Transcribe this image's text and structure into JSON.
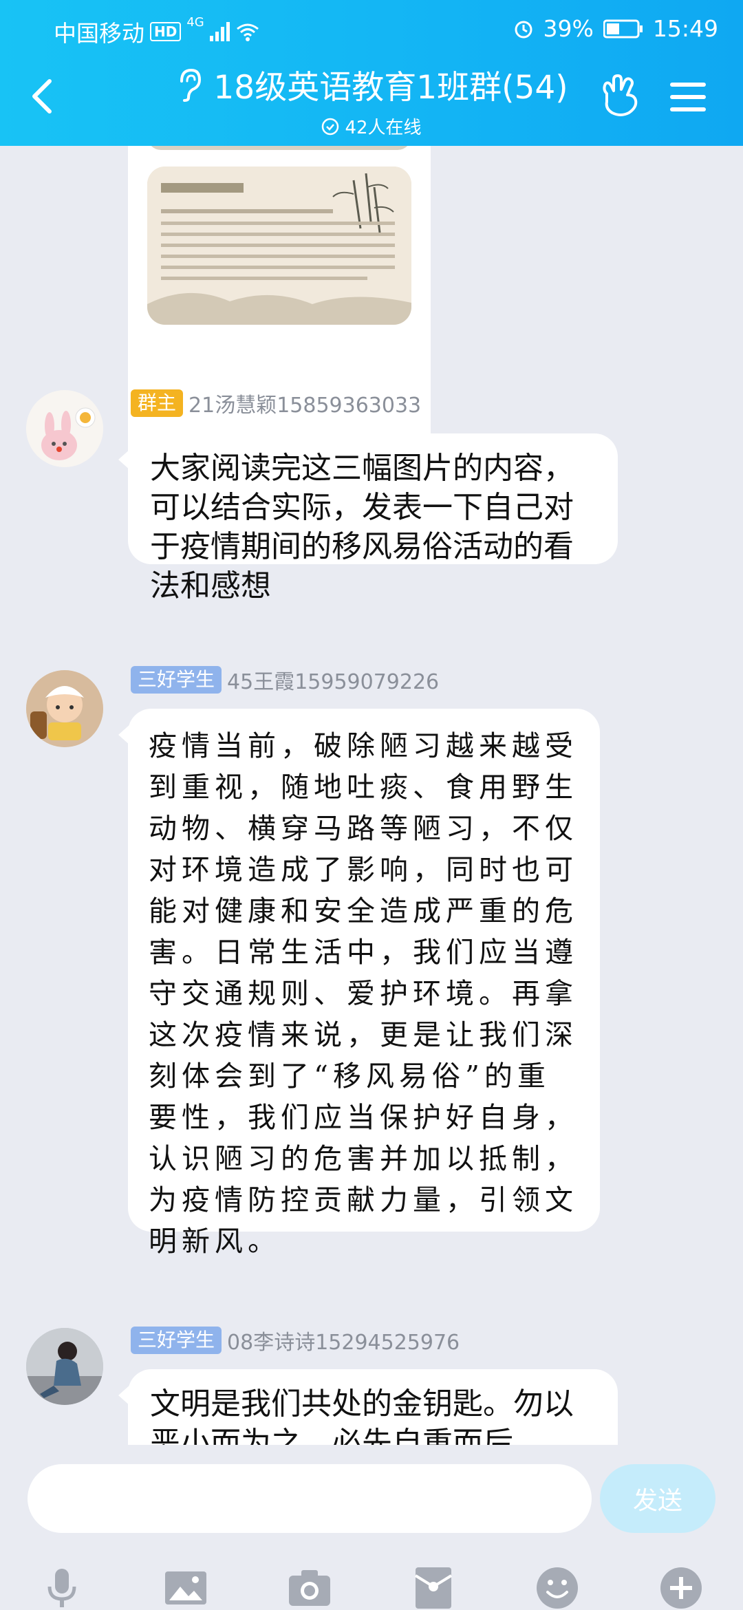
{
  "status_bar": {
    "carrier": "中国移动",
    "hd": "HD",
    "network": "4G",
    "battery": "39%",
    "time": "15:49"
  },
  "header": {
    "title": "18级英语教育1班群(54)",
    "online": "42人在线"
  },
  "messages": [
    {
      "badge": "群主",
      "sender": "21汤慧颖15859363033",
      "text": "大家阅读完这三幅图片的内容，可以结合实际，发表一下自己对于疫情期间的移风易俗活动的看法和感想"
    },
    {
      "badge": "三好学生",
      "sender": "45王霞15959079226",
      "text": "疫情当前，破除陋习越来越受到重视，随地吐痰、食用野生动物、横穿马路等陋习，不仅对环境造成了影响，同时也可能对健康和安全造成严重的危害。日常生活中，我们应当遵守交通规则、爱护环境。再拿这次疫情来说，更是让我们深刻体会到了“移风易俗”的重要性，我们应当保护好自身，认识陋习的危害并加以抵制，为疫情防控贡献力量，引领文明新风。"
    },
    {
      "badge": "三好学生",
      "sender": "08李诗诗15294525976",
      "text": "文明是我们共处的金钥匙。勿以恶小而为之，必先自重而后"
    }
  ],
  "input": {
    "send_label": "发送"
  },
  "colors": {
    "header": "#13b4f4",
    "owner_badge": "#f4b321",
    "student_badge": "#8fb3ec",
    "send_button": "#c5ecfb"
  },
  "icons": [
    "back-icon",
    "ear-icon",
    "check-circle-icon",
    "hand-icon",
    "menu-icon",
    "microphone-icon",
    "image-icon",
    "camera-icon",
    "red-packet-icon",
    "emoji-icon",
    "plus-icon"
  ]
}
